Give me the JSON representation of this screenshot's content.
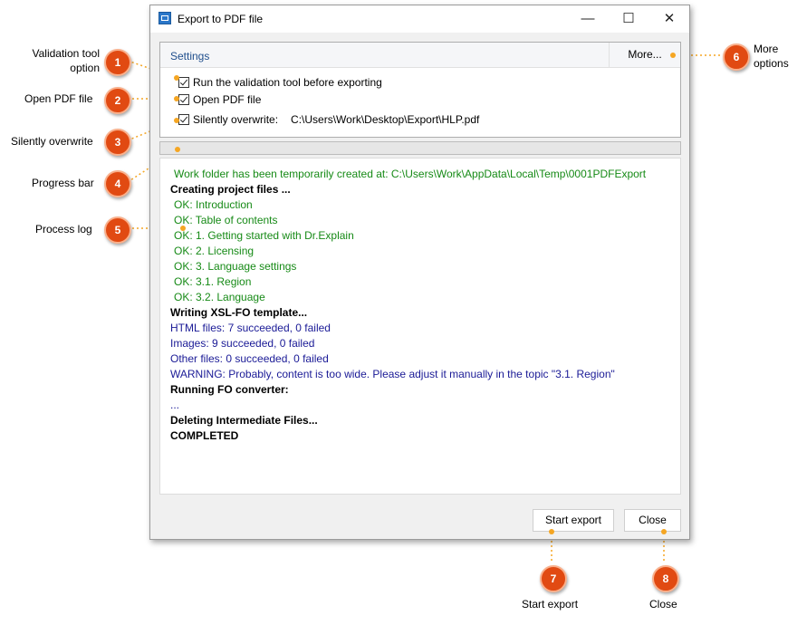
{
  "window": {
    "title": "Export to PDF file",
    "minimize": "—",
    "maximize": "☐",
    "close": "✕"
  },
  "settings": {
    "header": "Settings",
    "more_button": "More...",
    "options": [
      {
        "label": "Run the validation tool before exporting",
        "checked": true
      },
      {
        "label": "Open PDF file",
        "checked": true
      },
      {
        "label": "Silently overwrite:",
        "checked": true,
        "path": "C:\\Users\\Work\\Desktop\\Export\\HLP.pdf"
      }
    ]
  },
  "progress": {
    "value": 0
  },
  "log": [
    {
      "text": "Work folder has been temporarily created at: C:\\Users\\Work\\AppData\\Local\\Temp\\0001PDFExport",
      "style": "green",
      "indent": true
    },
    {
      "text": "Creating project files ...",
      "style": "bold"
    },
    {
      "text": "OK: Introduction",
      "style": "green",
      "indent": true
    },
    {
      "text": "OK: Table of contents",
      "style": "green",
      "indent": true
    },
    {
      "text": "OK: 1. Getting started with Dr.Explain",
      "style": "green",
      "indent": true
    },
    {
      "text": "OK: 2. Licensing",
      "style": "green",
      "indent": true
    },
    {
      "text": "OK: 3. Language settings",
      "style": "green",
      "indent": true
    },
    {
      "text": "OK: 3.1. Region",
      "style": "green",
      "indent": true
    },
    {
      "text": "OK: 3.2. Language",
      "style": "green",
      "indent": true
    },
    {
      "text": "Writing XSL-FO template...",
      "style": "bold"
    },
    {
      "text": "HTML files:  7 succeeded, 0 failed",
      "style": "blue"
    },
    {
      "text": "Images:  9 succeeded, 0 failed",
      "style": "blue"
    },
    {
      "text": "Other files:  0 succeeded, 0 failed",
      "style": "blue"
    },
    {
      "text": "WARNING: Probably, content is too wide. Please adjust it manually in the topic \"3.1. Region\"",
      "style": "blue"
    },
    {
      "text": "Running FO converter:",
      "style": "bold"
    },
    {
      "text": "...",
      "style": "plain"
    },
    {
      "text": "Deleting Intermediate Files...",
      "style": "bold"
    },
    {
      "text": "COMPLETED",
      "style": "bold"
    }
  ],
  "buttons": {
    "start_export": "Start export",
    "close": "Close"
  },
  "callouts": [
    {
      "num": "1",
      "label": "Validation tool option"
    },
    {
      "num": "2",
      "label": "Open PDF file"
    },
    {
      "num": "3",
      "label": "Silently overwrite"
    },
    {
      "num": "4",
      "label": "Progress bar"
    },
    {
      "num": "5",
      "label": "Process log"
    },
    {
      "num": "6",
      "label": "More options"
    },
    {
      "num": "7",
      "label": "Start export"
    },
    {
      "num": "8",
      "label": "Close"
    }
  ],
  "colors": {
    "callout": "#e14a12",
    "connector": "#f5a623",
    "log_green": "#168a16",
    "log_blue": "#1a1a96",
    "settings_header": "#1f4e8c"
  }
}
